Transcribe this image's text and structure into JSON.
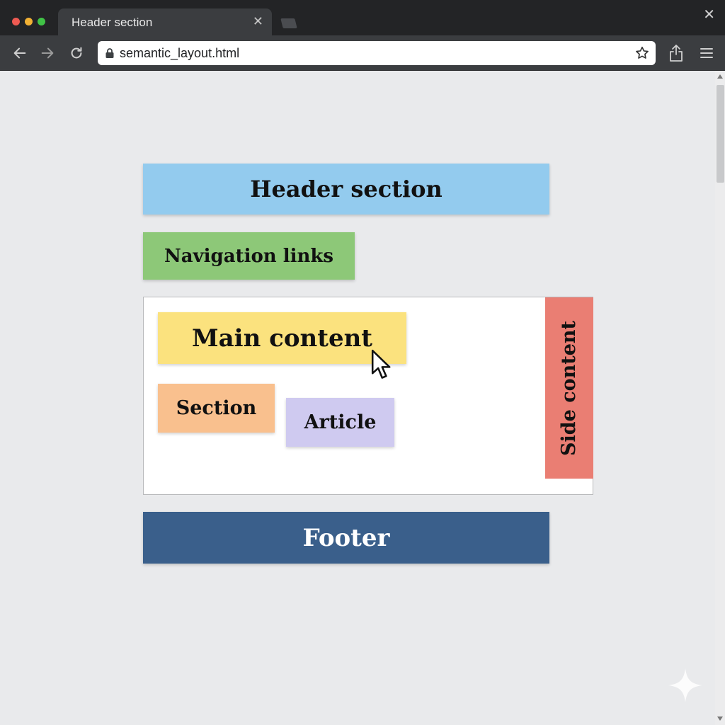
{
  "browser": {
    "tab_title": "Header section",
    "tab_close_glyph": "✕",
    "window_close_glyph": "✕",
    "url": "semantic_layout.html"
  },
  "icons": {
    "back": "back-arrow-icon",
    "forward": "forward-arrow-icon",
    "reload": "reload-icon",
    "lock": "lock-icon",
    "bookmark": "star-icon",
    "share": "share-icon",
    "menu": "hamburger-menu-icon",
    "pointer": "mouse-cursor-icon",
    "watermark": "sparkle-icon"
  },
  "page": {
    "header_label": "Header section",
    "nav_label": "Navigation links",
    "main_label": "Main content",
    "section_label": "Section",
    "article_label": "Article",
    "aside_label": "Side content",
    "footer_label": "Footer"
  },
  "colors": {
    "header": "#93cbee",
    "nav": "#8dc878",
    "main": "#fbe27e",
    "section": "#f9c08e",
    "article": "#cfcaf0",
    "aside": "#ea7e73",
    "footer": "#3a5f8b"
  }
}
